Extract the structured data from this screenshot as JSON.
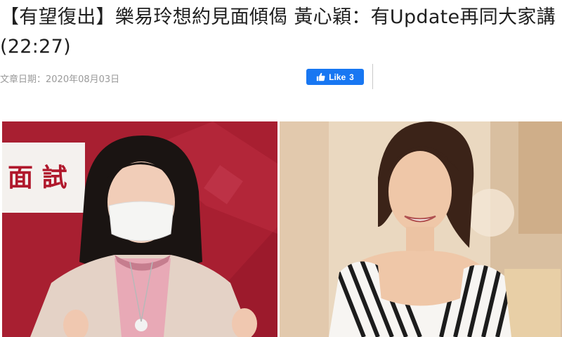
{
  "article": {
    "headline": "【有望復出】樂易玲想約見面傾偈 黃心穎：有Update再同大家講 (22:27)",
    "date": "文章日期：2020年08月03日"
  },
  "social": {
    "like_label": "Like",
    "like_count": "3",
    "like_color": "#1877f2",
    "like_icon": "thumbs-up-icon"
  },
  "photos": {
    "left_sign_text": "面 試",
    "left_backdrop_color": "#a01c2e",
    "right_backdrop_color": "#e9d6bf"
  }
}
